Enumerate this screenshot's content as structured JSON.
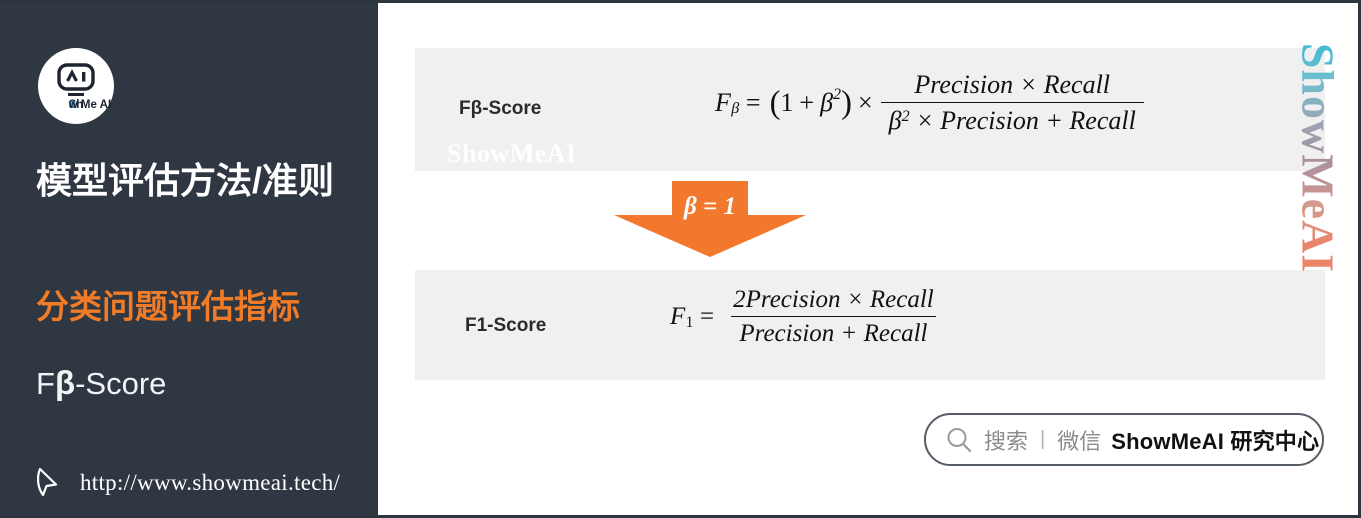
{
  "sidebar": {
    "logo_icon": "showmeai-robot-logo",
    "logo_text": "Show Me AI",
    "title": "模型评估方法/准则",
    "subtitle": "分类问题评估指标",
    "topic_prefix": "F",
    "topic_beta": "β",
    "topic_suffix": "-Score",
    "cursor_icon": "cursor-pointer-icon",
    "url": "http://www.showmeai.tech/",
    "background_color": "#2f3743",
    "accent_color": "#f07c28"
  },
  "main": {
    "panel_beta": {
      "label": "Fβ-Score",
      "watermark": "ShowMeAI",
      "formula": {
        "lhs_var": "F",
        "lhs_sub": "β",
        "equals": "=",
        "open_paren": "(",
        "one": "1",
        "plus": "+",
        "beta": "β",
        "beta_exp": "2",
        "close_paren": ")",
        "times": "×",
        "numerator": "Precision × Recall",
        "denominator_beta": "β",
        "denominator_beta_exp": "2",
        "denominator_rest": "× Precision + Recall"
      }
    },
    "arrow": {
      "label": "β = 1",
      "color": "#f2782e",
      "direction": "down"
    },
    "panel_f1": {
      "label": "F1-Score",
      "formula": {
        "lhs_var": "F",
        "lhs_sub": "1",
        "equals": "=",
        "numerator": "2Precision × Recall",
        "denominator": "Precision + Recall"
      }
    },
    "vertical_brand": "ShowMeAI",
    "search": {
      "icon": "search-magnifier-icon",
      "placeholder_cn": "搜索",
      "divider": "|",
      "channel": "微信",
      "brand": "ShowMeAI 研究中心"
    }
  }
}
